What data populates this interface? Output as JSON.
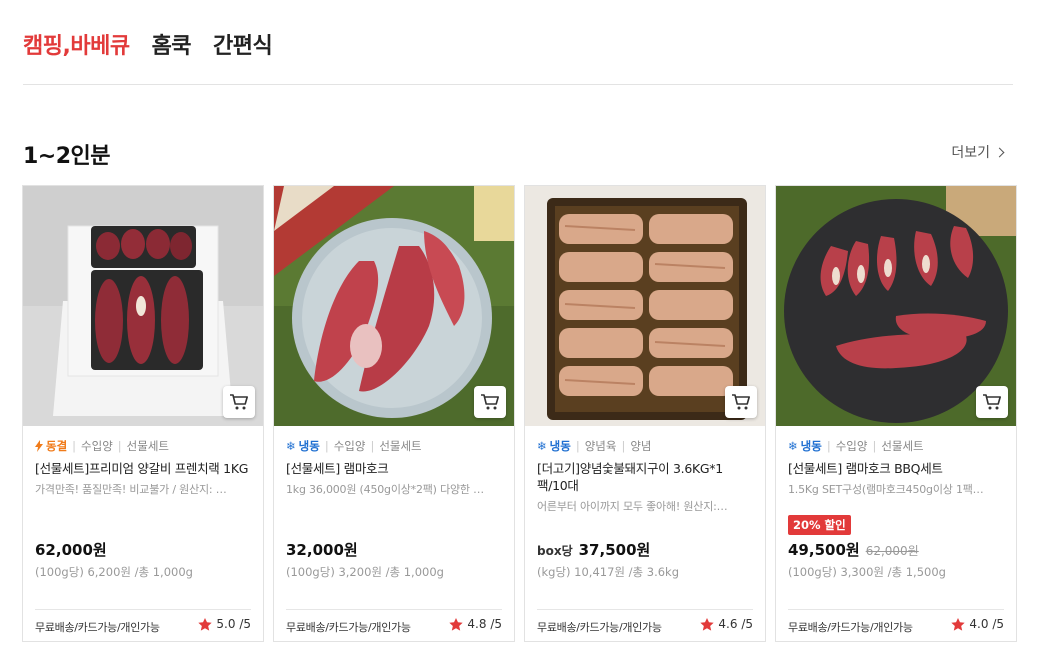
{
  "tabs": [
    {
      "label": "캠핑,바베큐",
      "active": true
    },
    {
      "label": "홈쿡",
      "active": false
    },
    {
      "label": "간편식",
      "active": false
    }
  ],
  "section": {
    "title": "1~2인분",
    "more_label": "더보기"
  },
  "products": [
    {
      "tag_main": "동결",
      "tag_icon": "lightning-icon",
      "tags": [
        "수입양",
        "선물세트"
      ],
      "name": "[선물세트]프리미엄 양갈비 프렌치랙 1KG",
      "desc": "가격만족! 품질만족! 비교불가 / 원산지: …",
      "badge": "",
      "price_unit": "",
      "price": "62,000원",
      "orig_price": "",
      "per_unit": "(100g당) 6,200원 /총 1,000g",
      "shipping": "무료배송/카드가능/개인가능",
      "rating": "5.0 /5"
    },
    {
      "tag_main": "냉동",
      "tag_icon": "snowflake-icon",
      "tags": [
        "수입양",
        "선물세트"
      ],
      "name": "[선물세트] 램마호크",
      "desc": "1kg 36,000원 (450g이상*2팩) 다양한 …",
      "badge": "",
      "price_unit": "",
      "price": "32,000원",
      "orig_price": "",
      "per_unit": "(100g당) 3,200원 /총 1,000g",
      "shipping": "무료배송/카드가능/개인가능",
      "rating": "4.8 /5"
    },
    {
      "tag_main": "냉동",
      "tag_icon": "snowflake-icon",
      "tags": [
        "양념육",
        "양념"
      ],
      "name": "[더고기]양념숯불돼지구이 3.6KG*1팩/10대",
      "desc": "어른부터 아이까지 모두 좋아해! 원산지:…",
      "badge": "",
      "price_unit": "box당",
      "price": "37,500원",
      "orig_price": "",
      "per_unit": "(kg당) 10,417원 /총 3.6kg",
      "shipping": "무료배송/카드가능/개인가능",
      "rating": "4.6 /5"
    },
    {
      "tag_main": "냉동",
      "tag_icon": "snowflake-icon",
      "tags": [
        "수입양",
        "선물세트"
      ],
      "name": "[선물세트] 램마호크 BBQ세트",
      "desc": "1.5Kg SET구성(램마호크450g이상 1팩…",
      "badge": "20% 할인",
      "price_unit": "",
      "price": "49,500원",
      "orig_price": "62,000원",
      "per_unit": "(100g당) 3,300원 /총 1,500g",
      "shipping": "무료배송/카드가능/개인가능",
      "rating": "4.0 /5"
    }
  ],
  "colors": {
    "accent": "#e23a3a",
    "freeze_blue": "#1f6fd1",
    "lightning_orange": "#f07b1a",
    "star": "#e23a3a"
  }
}
